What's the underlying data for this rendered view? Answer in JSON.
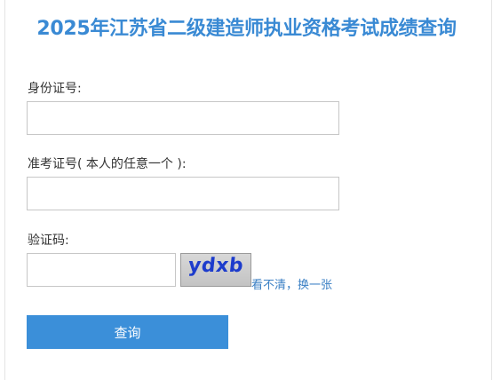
{
  "title": "2025年江苏省二级建造师执业资格考试成绩查询",
  "form": {
    "id_label": "身份证号:",
    "id_value": "",
    "exam_no_label": "准考证号( 本人的任意一个 ):",
    "exam_no_value": "",
    "captcha_label": "验证码:",
    "captcha_value": "",
    "captcha_image_text": "ydxb",
    "refresh_link": "看不清，换一张",
    "submit_label": "查询"
  },
  "colors": {
    "title": "#3a8ad4",
    "button": "#3b8fd9",
    "link": "#3a7fc4",
    "captcha_text": "#1d3ccc"
  }
}
